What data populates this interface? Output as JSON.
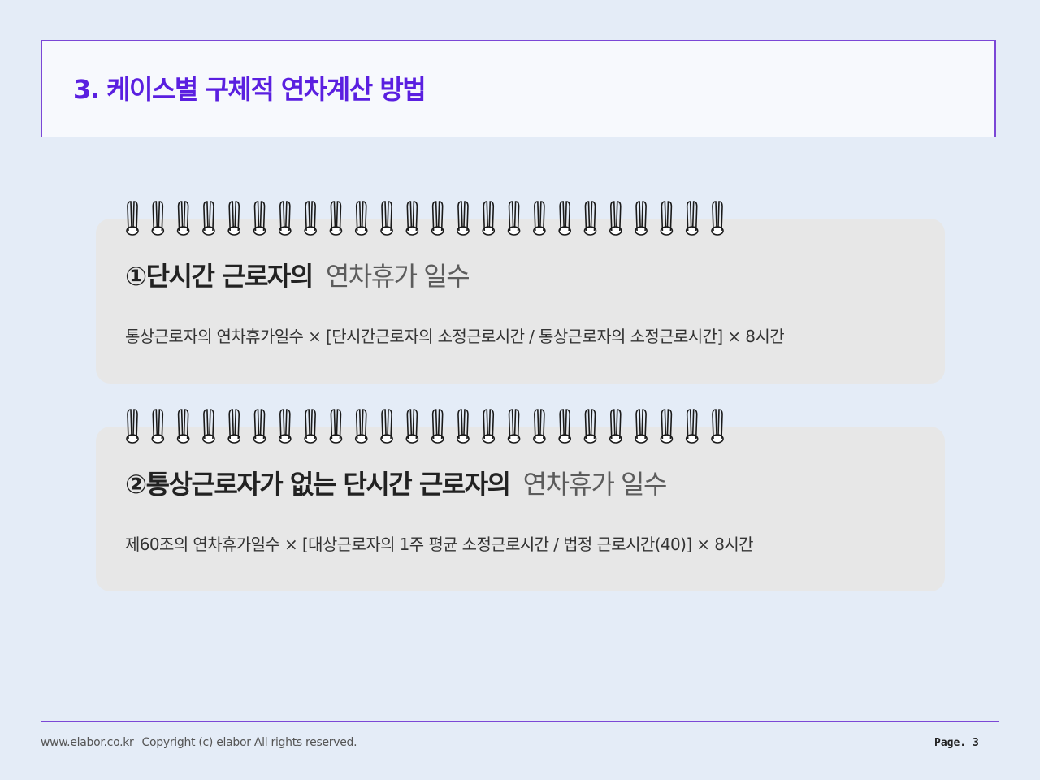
{
  "header": {
    "title": "3. 케이스별 구체적 연차계산 방법"
  },
  "cards": [
    {
      "heading_bold": "①단시간 근로자의",
      "heading_light": "연차휴가 일수",
      "formula": "통상근로자의 연차휴가일수 × [단시간근로자의 소정근로시간 / 통상근로자의 소정근로시간] × 8시간"
    },
    {
      "heading_bold": "②통상근로자가 없는 단시간 근로자의",
      "heading_light": "연차휴가 일수",
      "formula": "제60조의 연차휴가일수 × [대상근로자의 1주 평균 소정근로시간 / 법정 근로시간(40)] × 8시간"
    }
  ],
  "footer": {
    "site": "www.elabor.co.kr",
    "copyright": "Copyright (c) elabor All rights reserved.",
    "page": "Page. 3"
  },
  "decor": {
    "spiral_ring_count": 24,
    "spiral_icon": "notebook-spiral-ring-icon"
  },
  "colors": {
    "accent": "#5a1fe0",
    "border": "#7b47d6",
    "background": "#e4ecf7",
    "card": "#e7e7e7"
  }
}
